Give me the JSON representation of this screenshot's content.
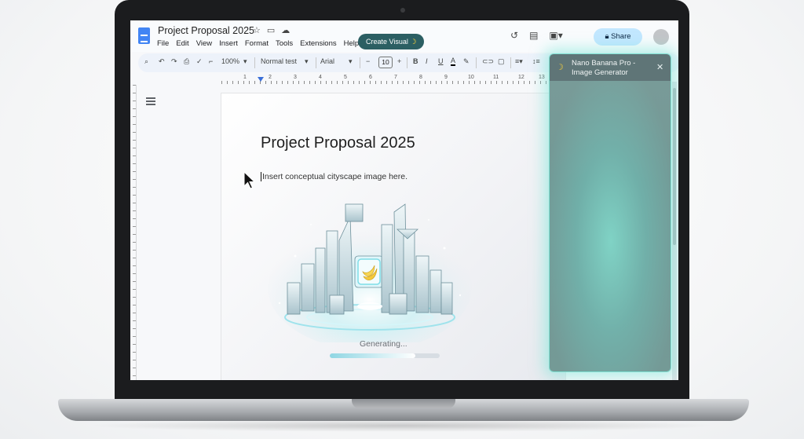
{
  "document": {
    "title": "Project Proposal 2025"
  },
  "menu": [
    "File",
    "Edit",
    "View",
    "Insert",
    "Format",
    "Tools",
    "Extensions",
    "Help"
  ],
  "create_visual": {
    "label": "Create Visual",
    "icon": "banana-icon"
  },
  "share": {
    "label": "Share",
    "icon": "lock-icon"
  },
  "toolbar": {
    "zoom": "100%",
    "style": "Normal test",
    "font": "Arial",
    "font_size": "10",
    "minus": "−",
    "plus": "+",
    "bold": "B",
    "italic": "I",
    "underline": "U",
    "text_color": "A"
  },
  "ruler": [
    "1",
    "2",
    "3",
    "4",
    "5",
    "6",
    "7",
    "8",
    "9",
    "10",
    "11",
    "12",
    "13"
  ],
  "page": {
    "heading": "Project Proposal 2025",
    "placeholder": "Insert conceptual cityscape image here.",
    "status": "Generating...",
    "progress": 0.78
  },
  "panel": {
    "title": "Nano Banana Pro - Image Generator",
    "icon": "banana-icon",
    "close": "✕"
  },
  "colors": {
    "share_bg": "#c2e7ff",
    "create_visual_bg": "#2c5f63",
    "panel_glow": "#7fe0d3"
  }
}
